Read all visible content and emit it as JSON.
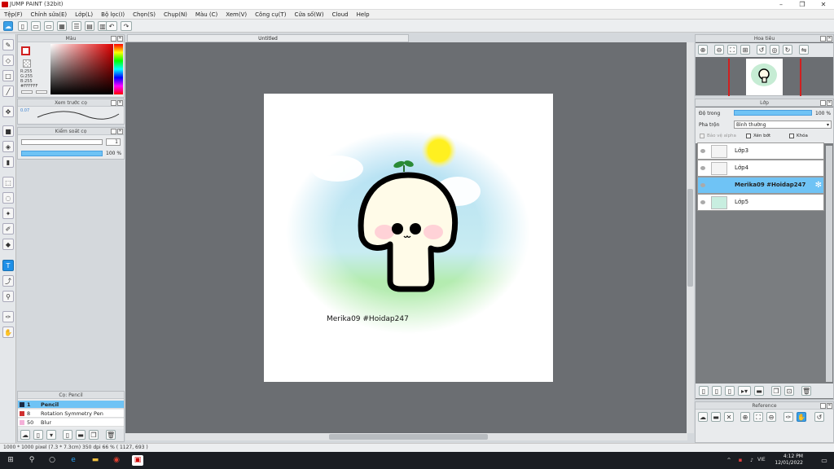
{
  "window": {
    "title": "JUMP PAINT (32bit)"
  },
  "menu": [
    "Tệp(F)",
    "Chỉnh sửa(E)",
    "Lớp(L)",
    "Bộ lọc(I)",
    "Chọn(S)",
    "Chụp(N)",
    "Màu (C)",
    "Xem(V)",
    "Công cụ(T)",
    "Cửa số(W)",
    "Cloud",
    "Help"
  ],
  "document": {
    "tab_title": "Untitled",
    "text": "Merika09 #Hoidap247"
  },
  "color_panel": {
    "title": "Màu",
    "r": "R:255",
    "g": "G:255",
    "b": "B:255",
    "hex": "#FFFFFF"
  },
  "brush_preview": {
    "title": "Xem trước cọ",
    "size": "0.07"
  },
  "brush_control": {
    "title": "Kiểm soát cọ",
    "size_value": "1",
    "opacity_value": "100 %"
  },
  "brush_list": {
    "title": "Cọ: Pencil",
    "items": [
      {
        "size": "1",
        "name": "Pencil",
        "color": "#1a2a44",
        "selected": true
      },
      {
        "size": "8",
        "name": "Rotation Symmetry Pen",
        "color": "#d03030",
        "selected": false
      },
      {
        "size": "50",
        "name": "Blur",
        "color": "#f4b0d8",
        "selected": false
      }
    ]
  },
  "navigator": {
    "title": "Hoa tiêu"
  },
  "layers": {
    "title": "Lớp",
    "opacity_label": "Độ trong",
    "opacity_value": "100 %",
    "blend_label": "Pha trộn",
    "blend_value": "Bình thường",
    "check_protect": "Bảo vệ alpha",
    "check_clip": "Xén bớt",
    "check_lock": "Khóa",
    "items": [
      {
        "name": "Lớp3",
        "selected": false
      },
      {
        "name": "Lớp4",
        "selected": false
      },
      {
        "name": "Merika09 #Hoidap247",
        "selected": true
      },
      {
        "name": "Lớp5",
        "selected": false
      }
    ]
  },
  "reference": {
    "title": "Reference"
  },
  "status": {
    "text": "1000 * 1000 pixel  (7.3 * 7.3cm)  350 dpi  66 %  ( 1127, 693 )"
  },
  "taskbar": {
    "time": "4:12 PM",
    "date": "12/01/2022",
    "lang": "VIE"
  },
  "colors": {
    "accent": "#3aa0e8",
    "selected_row": "#6fc3f5"
  }
}
